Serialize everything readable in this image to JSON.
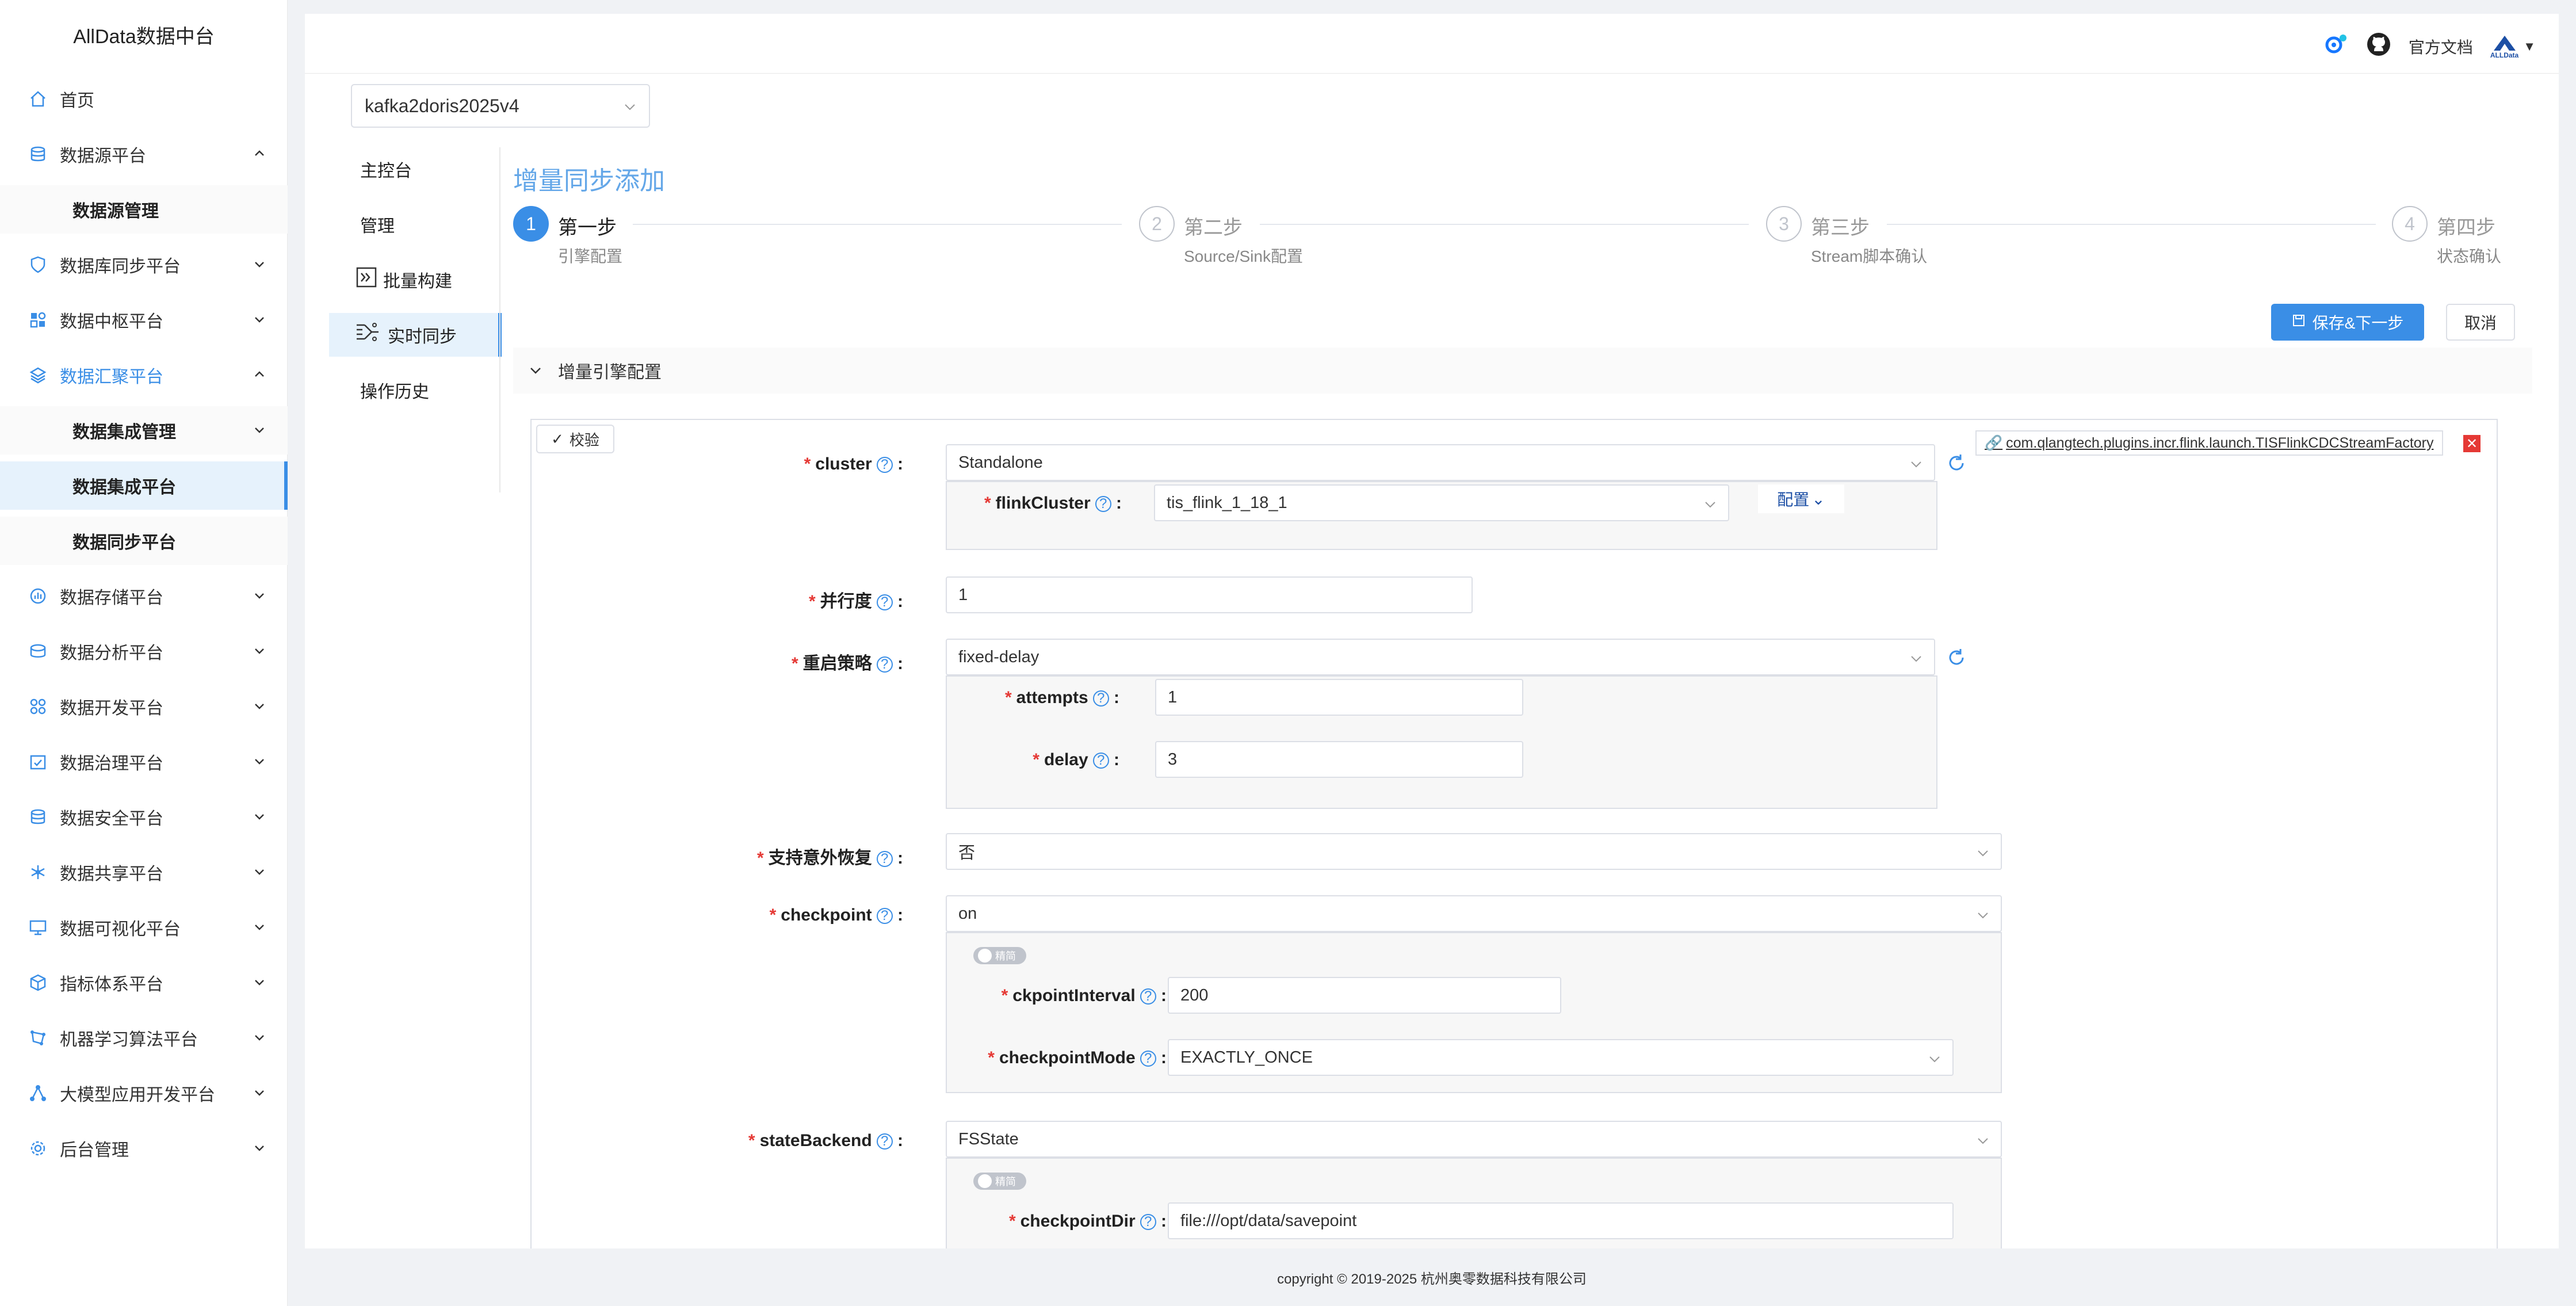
{
  "app_title": "AllData数据中台",
  "sidebar": {
    "items": [
      {
        "label": "首页"
      },
      {
        "label": "数据源平台"
      },
      {
        "label": "数据源管理"
      },
      {
        "label": "数据库同步平台"
      },
      {
        "label": "数据中枢平台"
      },
      {
        "label": "数据汇聚平台"
      },
      {
        "label": "数据集成管理"
      },
      {
        "label": "数据集成平台"
      },
      {
        "label": "数据同步平台"
      },
      {
        "label": "数据存储平台"
      },
      {
        "label": "数据分析平台"
      },
      {
        "label": "数据开发平台"
      },
      {
        "label": "数据治理平台"
      },
      {
        "label": "数据安全平台"
      },
      {
        "label": "数据共享平台"
      },
      {
        "label": "数据可视化平台"
      },
      {
        "label": "指标体系平台"
      },
      {
        "label": "机器学习算法平台"
      },
      {
        "label": "大模型应用开发平台"
      },
      {
        "label": "后台管理"
      }
    ]
  },
  "header": {
    "docs": "官方文档",
    "brand": "ALLData"
  },
  "pipeline_select": "kafka2doris2025v4",
  "subnav": [
    {
      "label": "主控台"
    },
    {
      "label": "管理"
    },
    {
      "label": "批量构建"
    },
    {
      "label": "实时同步"
    },
    {
      "label": "操作历史"
    }
  ],
  "page_title": "增量同步添加",
  "steps": [
    {
      "num": "1",
      "title": "第一步",
      "desc": "引擎配置"
    },
    {
      "num": "2",
      "title": "第二步",
      "desc": "Source/Sink配置"
    },
    {
      "num": "3",
      "title": "第三步",
      "desc": "Stream脚本确认"
    },
    {
      "num": "4",
      "title": "第四步",
      "desc": "状态确认"
    }
  ],
  "buttons": {
    "save_next": "保存&下一步",
    "cancel": "取消",
    "validate": "校验",
    "config": "配置"
  },
  "section_title": "增量引擎配置",
  "plugin_link": "com.qlangtech.plugins.incr.flink.launch.TISFlinkCDCStreamFactory",
  "form": {
    "cluster": {
      "label": "cluster",
      "value": "Standalone"
    },
    "flinkCluster": {
      "label": "flinkCluster",
      "value": "tis_flink_1_18_1"
    },
    "parallelism": {
      "label": "并行度",
      "value": "1"
    },
    "restart": {
      "label": "重启策略",
      "value": "fixed-delay"
    },
    "attempts": {
      "label": "attempts",
      "value": "1"
    },
    "delay": {
      "label": "delay",
      "value": "3"
    },
    "recovery": {
      "label": "支持意外恢复",
      "value": "否"
    },
    "checkpoint": {
      "label": "checkpoint",
      "value": "on"
    },
    "toggle_label": "精简",
    "ckpointInterval": {
      "label": "ckpointInterval",
      "value": "200"
    },
    "checkpointMode": {
      "label": "checkpointMode",
      "value": "EXACTLY_ONCE"
    },
    "stateBackend": {
      "label": "stateBackend",
      "value": "FSState"
    },
    "checkpointDir": {
      "label": "checkpointDir",
      "value": "file:///opt/data/savepoint"
    }
  },
  "footer": "copyright © 2019-2025 杭州奥零数据科技有限公司",
  "colors": {
    "accent": "#3a8ee6",
    "required": "#e53935",
    "title": "#64a7e8"
  }
}
